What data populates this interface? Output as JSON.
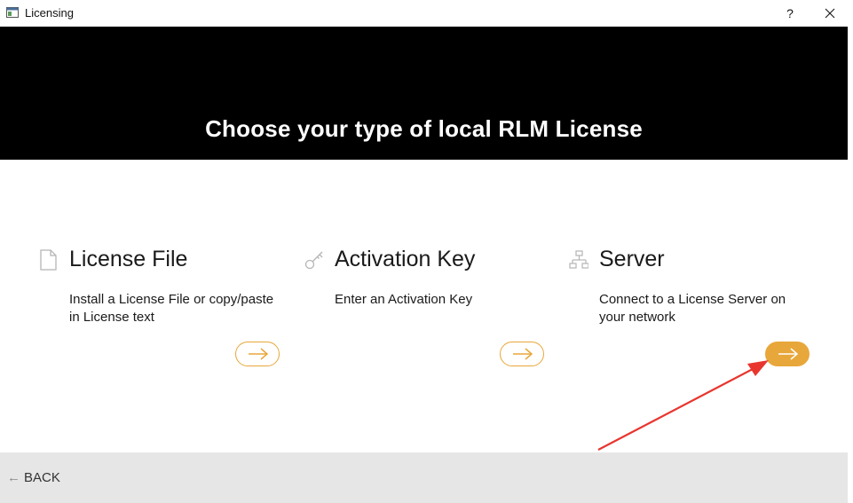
{
  "window": {
    "title": "Licensing",
    "help_label": "?",
    "app_icon": "window-icon",
    "close_icon": "close-icon"
  },
  "banner": {
    "title": "Choose your type of local RLM License"
  },
  "options": [
    {
      "icon": "document-icon",
      "heading": "License File",
      "description": "Install a License File or copy/paste in License text",
      "arrow": "arrow-right-icon",
      "highlighted": false
    },
    {
      "icon": "key-icon",
      "heading": "Activation Key",
      "description": "Enter an Activation Key",
      "arrow": "arrow-right-icon",
      "highlighted": false
    },
    {
      "icon": "network-icon",
      "heading": "Server",
      "description": "Connect to a License Server on your network",
      "arrow": "arrow-right-icon",
      "highlighted": true
    }
  ],
  "footer": {
    "back_label": "BACK",
    "back_icon": "arrow-left-icon"
  },
  "colors": {
    "accent": "#e8a73a",
    "banner_bg": "#000000",
    "footer_bg": "#e6e6e6",
    "annotation": "#e8362f"
  }
}
